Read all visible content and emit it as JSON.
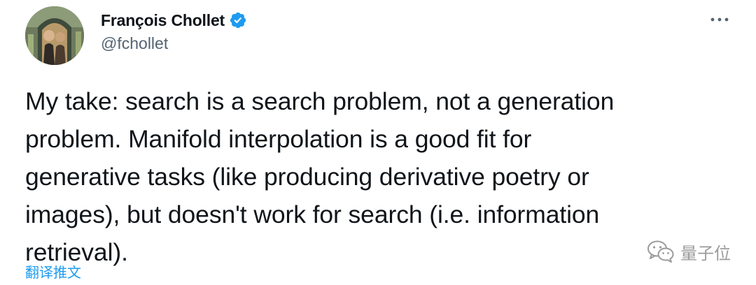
{
  "author": {
    "display_name": "François Chollet",
    "handle": "@fchollet",
    "verified": true,
    "verified_color": "#1d9bf0",
    "avatar_icon": "avatar-photo"
  },
  "menu": {
    "icon": "more-horizontal-icon"
  },
  "tweet": {
    "text": "My take: search is a search problem, not a generation\nproblem. Manifold interpolation is a good fit for\ngenerative tasks (like producing derivative poetry or\nimages), but doesn't work for search (i.e. information\nretrieval)."
  },
  "translate_label": "翻译推文",
  "watermark": {
    "text": "量子位",
    "icon": "wechat-icon"
  },
  "colors": {
    "accent": "#1d9bf0",
    "text": "#0f1419",
    "secondary": "#536471"
  }
}
